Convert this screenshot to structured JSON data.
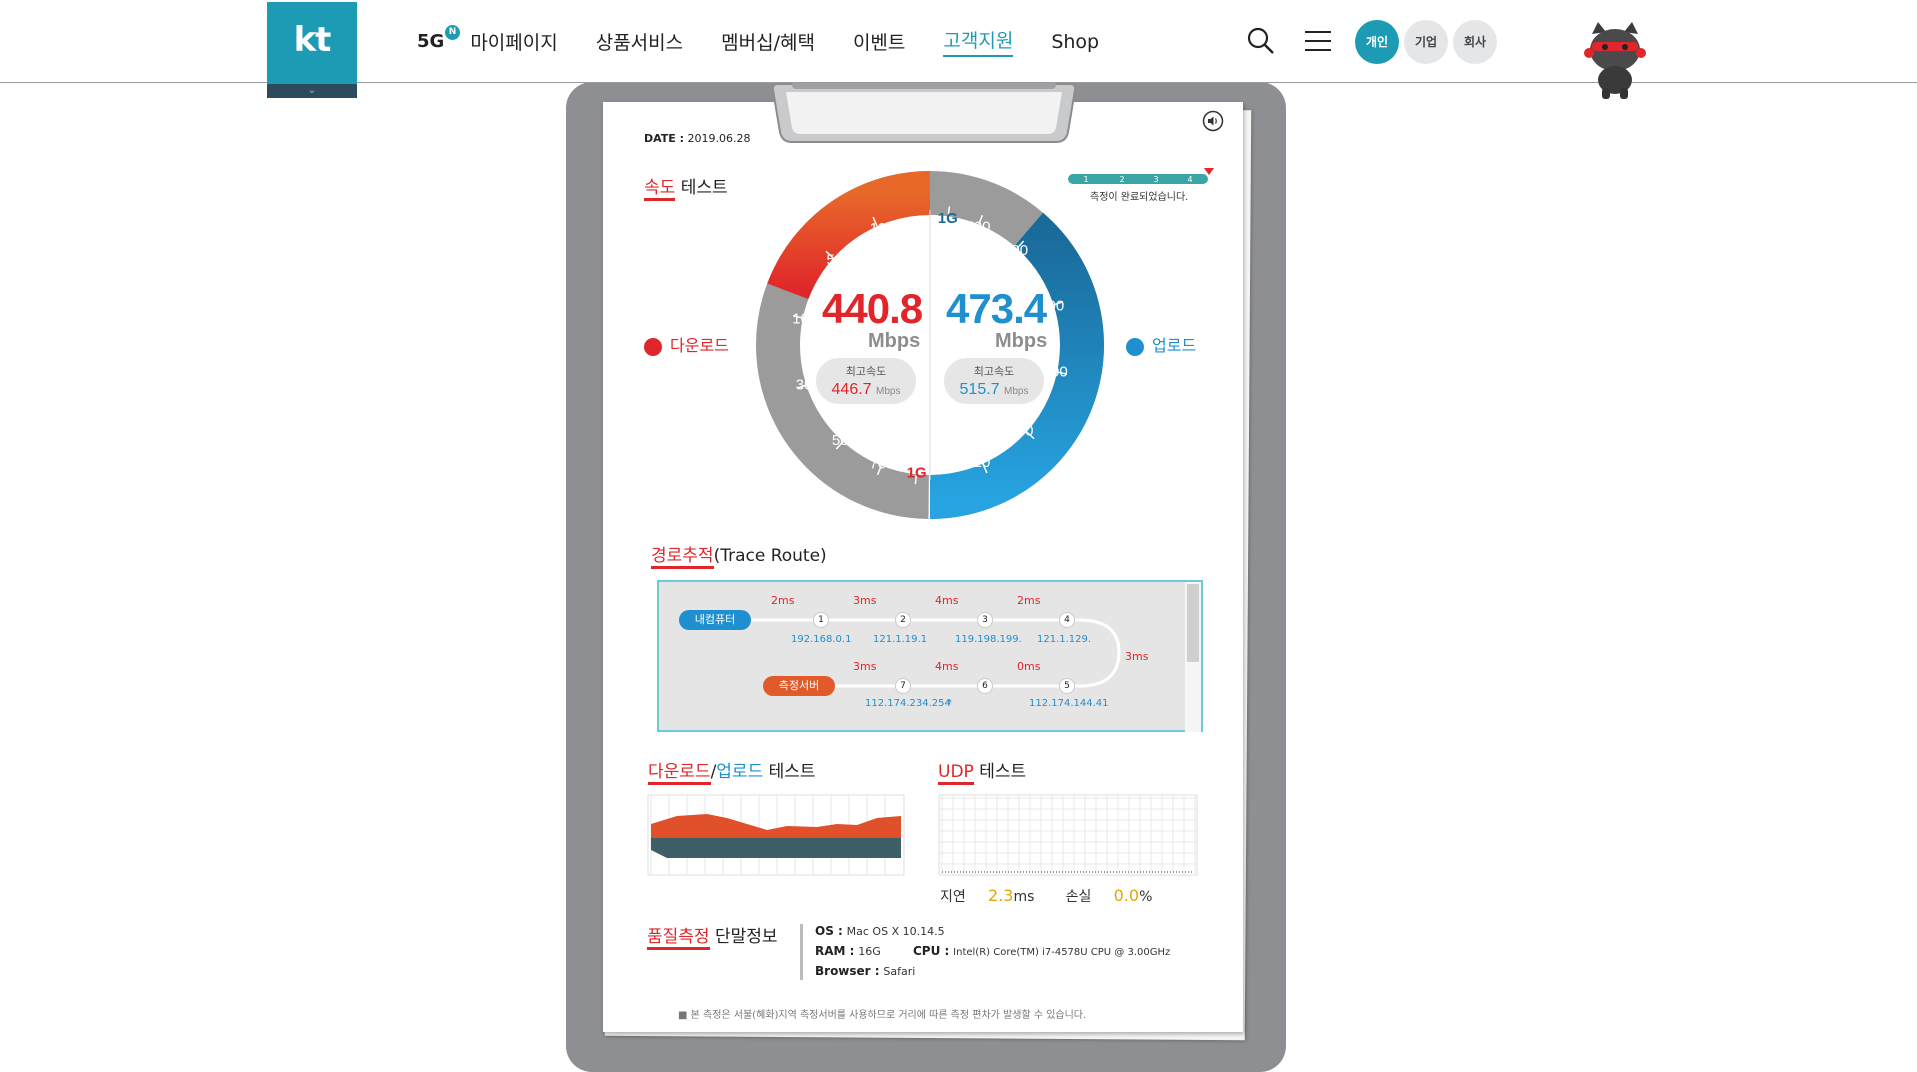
{
  "header": {
    "logo_text": "kt",
    "logo_tab": "⌄",
    "nav": [
      {
        "label": "5G",
        "badge": "N"
      },
      {
        "label": "마이페이지"
      },
      {
        "label": "상품서비스"
      },
      {
        "label": "멤버십/혜택"
      },
      {
        "label": "이벤트"
      },
      {
        "label": "고객지원",
        "active": true
      },
      {
        "label": "Shop"
      }
    ],
    "segments": [
      "개인",
      "기업",
      "회사"
    ],
    "accent": "#1d9bb5"
  },
  "report": {
    "date_label": "DATE :",
    "date": "2019.06.28",
    "speed_title_a": "속도",
    "speed_title_b": "테스트",
    "progress_steps": [
      "1",
      "2",
      "3",
      "4"
    ],
    "progress_note": "측정이 완료되었습니다.",
    "download_label": "다운로드",
    "upload_label": "업로드",
    "download_speed": "440.8",
    "upload_speed": "473.4",
    "unit": "Mbps",
    "max_label": "최고속도",
    "download_max": "446.7",
    "upload_max": "515.7",
    "gauge_left_ticks": [
      "10",
      "50",
      "100",
      "300",
      "500",
      "700",
      "1G"
    ],
    "gauge_right_ticks": [
      "1G",
      "700",
      "500",
      "300",
      "100",
      "50",
      "10"
    ],
    "download_color": "#e0262a",
    "upload_color": "#1f8fd0",
    "download_fraction": 0.385,
    "upload_fraction": 0.775
  },
  "trace": {
    "title_a": "경로추적",
    "title_b": "(Trace Route)",
    "start_label": "내컴퓨터",
    "end_label": "측정서버",
    "top_hops": [
      {
        "n": "1",
        "ms": "2ms",
        "ip": "192.168.0.1"
      },
      {
        "n": "2",
        "ms": "3ms",
        "ip": "121.1.19.1"
      },
      {
        "n": "3",
        "ms": "4ms",
        "ip": "119.198.199."
      },
      {
        "n": "4",
        "ms": "2ms",
        "ip": "121.1.129."
      }
    ],
    "turn_ms": "3ms",
    "bottom_hops": [
      {
        "n": "5",
        "ms": "0ms",
        "ip": "112.174.144.41"
      },
      {
        "n": "6",
        "ms": "4ms",
        "ip": "*"
      },
      {
        "n": "7",
        "ms": "3ms",
        "ip": "112.174.234.254"
      }
    ]
  },
  "dlul": {
    "title_a": "다운로드",
    "title_sep": "/",
    "title_b": "업로드",
    "title_c": "테스트"
  },
  "udp": {
    "title_a": "UDP",
    "title_b": "테스트",
    "latency_label": "지연",
    "latency_value": "2.3",
    "latency_unit": "ms",
    "loss_label": "손실",
    "loss_value": "0.0",
    "loss_unit": "%"
  },
  "device": {
    "title_a": "품질측정",
    "title_b": "단말정보",
    "os_label": "OS :",
    "os_value": "Mac OS X 10.14.5",
    "ram_label": "RAM :",
    "ram_value": "16G",
    "cpu_label": "CPU :",
    "cpu_value": "Intel(R) Core(TM) i7-4578U CPU @ 3.00GHz",
    "browser_label": "Browser :",
    "browser_value": "Safari"
  },
  "footnote": "■ 본 측정은 서불(혜화)지역 측정서버를 사용하므로 거리에 따른 측정 편차가 발생할 수 있습니다."
}
